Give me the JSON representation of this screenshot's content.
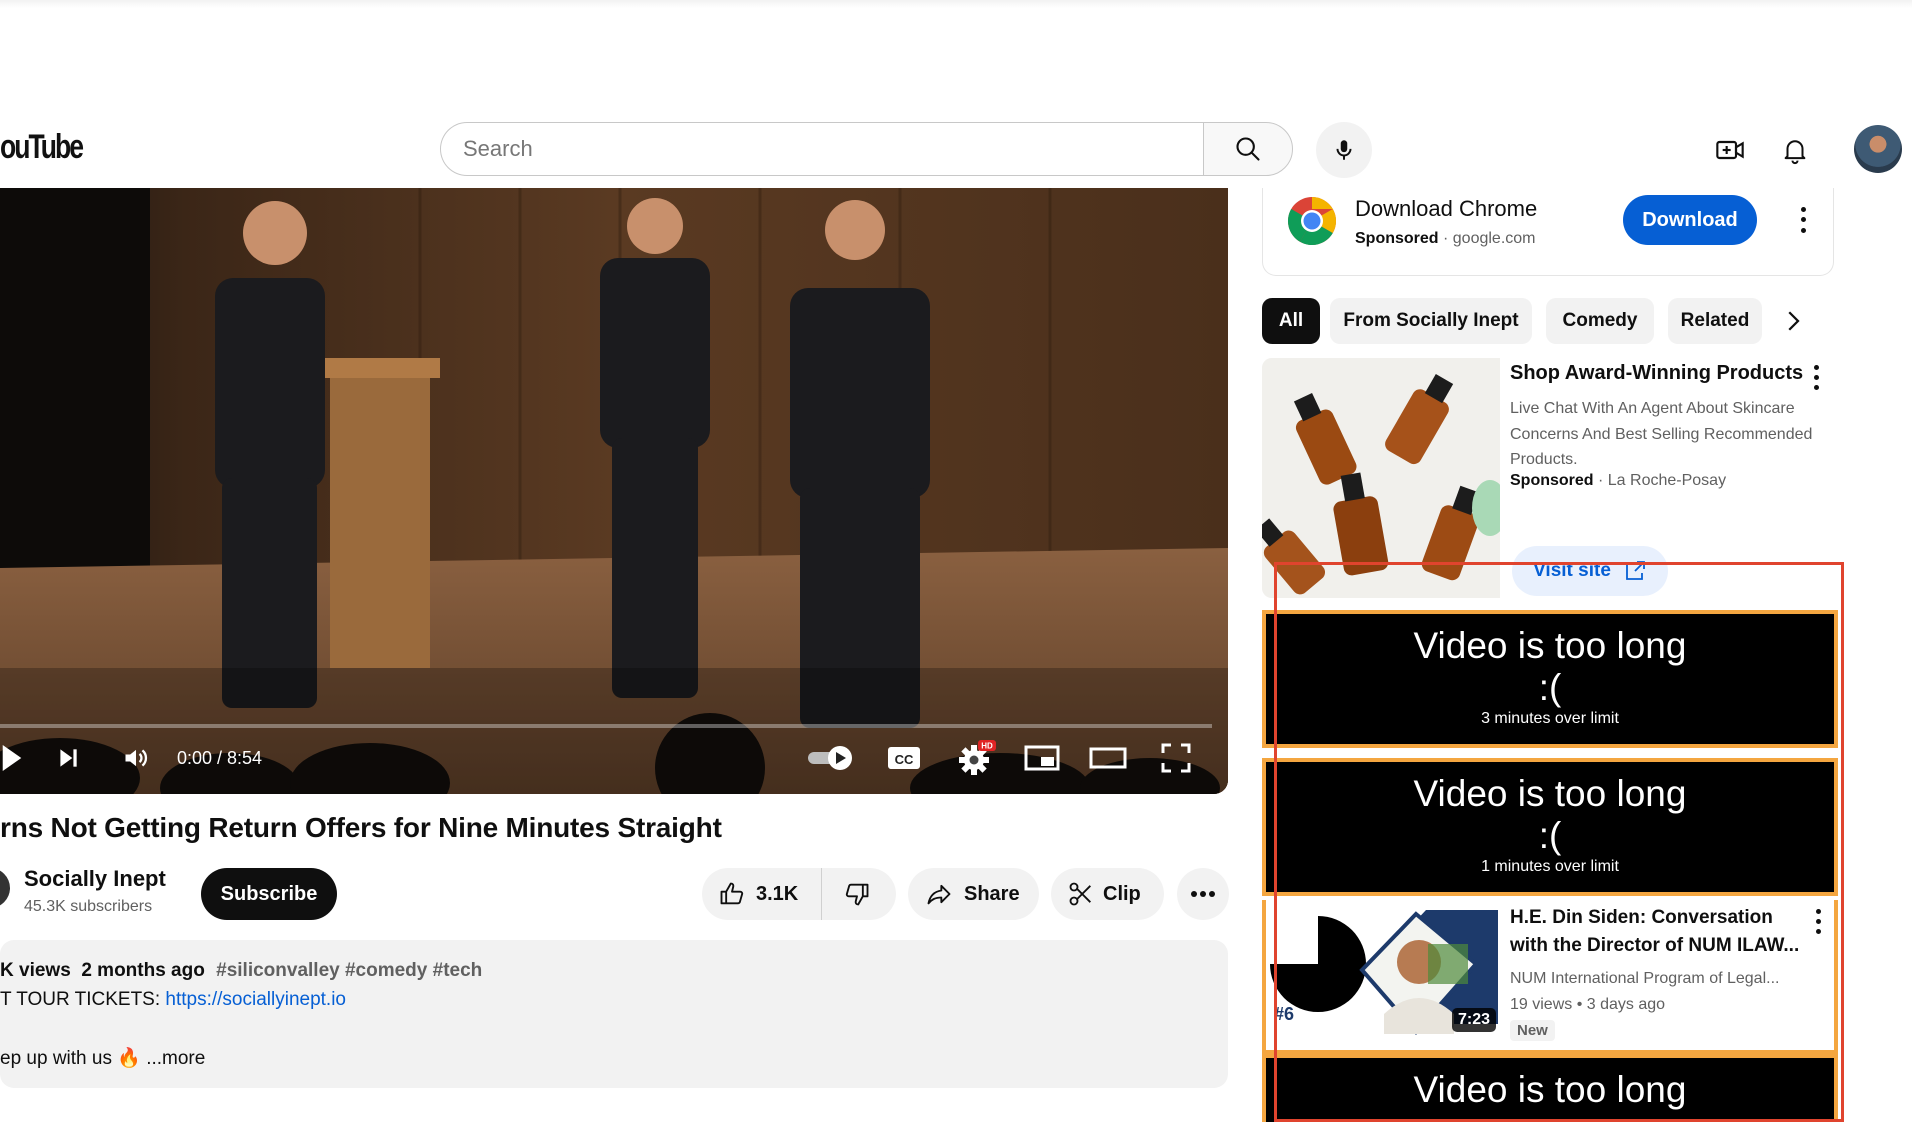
{
  "header": {
    "logo_text": "ouTube",
    "search_placeholder": "Search",
    "icons": [
      "search-icon",
      "mic-icon",
      "create-icon",
      "bell-icon"
    ]
  },
  "player": {
    "time": "0:00 / 8:54",
    "progress_fraction": 0.0,
    "hd_badge": "HD",
    "cc_label": "CC",
    "controls": [
      "play-icon",
      "next-icon",
      "volume-icon",
      "autoplay-toggle",
      "cc-icon",
      "settings-icon",
      "miniplayer-icon",
      "theater-icon",
      "fullscreen-icon"
    ]
  },
  "video": {
    "title": "rns Not Getting Return Offers for Nine Minutes Straight",
    "channel_name": "Socially Inept",
    "subscribers": "45.3K subscribers",
    "subscribe_label": "Subscribe",
    "likes": "3.1K",
    "share_label": "Share",
    "clip_label": "Clip"
  },
  "description": {
    "views": "K views",
    "date": "2 months ago",
    "tags": "#siliconvalley #comedy #tech",
    "line2_prefix": "T TOUR TICKETS: ",
    "link": "https://sociallyinept.io",
    "line3_text": "ep up with us",
    "line3_emoji": "🔥",
    "more": "...more"
  },
  "sidebar": {
    "ad": {
      "title": "Download Chrome",
      "sponsored": "Sponsored",
      "domain": "google.com",
      "button": "Download"
    },
    "chips": [
      "All",
      "From Socially Inept",
      "Comedy",
      "Related"
    ],
    "sponsored_product": {
      "title": "Shop Award-Winning Products",
      "description": "Live Chat With An Agent About Skincare Concerns And Best Selling Recommended Products.",
      "sponsored": "Sponsored",
      "advertiser": "La Roche-Posay",
      "visit": "Visit site"
    },
    "blocked": [
      {
        "title": "Video is too long",
        "face": ":(",
        "detail": "3 minutes over limit"
      },
      {
        "title": "Video is too long",
        "face": ":(",
        "detail": "1 minutes over limit"
      },
      {
        "title": "Video is too long",
        "face": ":(",
        "detail": ""
      }
    ],
    "video_item": {
      "title": "H.E. Din Siden: Conversation with the Director of NUM ILAW...",
      "channel": "NUM International Program of Legal...",
      "views": "19 views",
      "age": "3 days ago",
      "badge": "New",
      "duration": "7:23",
      "thumb_text": "#6"
    }
  },
  "colors": {
    "accent_blue": "#065fd4",
    "highlight_orange": "#f4a640",
    "outline_red": "#e0442e"
  }
}
